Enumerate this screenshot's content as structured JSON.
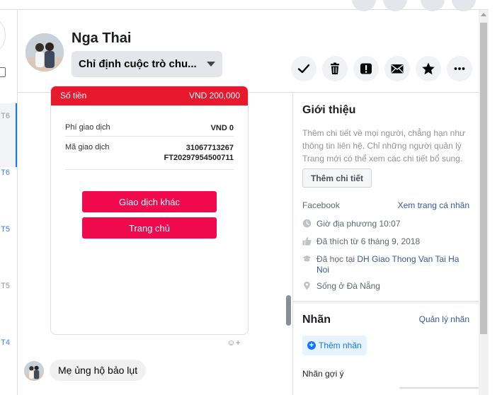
{
  "left_list": {
    "days": [
      "T6",
      "T6",
      "T5",
      "T5",
      "T4"
    ]
  },
  "contact": {
    "name": "Nga Thai",
    "assign_label": "Chỉ định cuộc trò chu..."
  },
  "actions": [
    {
      "name": "mark-done-button",
      "icon": "check-icon"
    },
    {
      "name": "delete-button",
      "icon": "trash-icon"
    },
    {
      "name": "report-button",
      "icon": "alert-icon"
    },
    {
      "name": "mark-unread-button",
      "icon": "envelope-icon"
    },
    {
      "name": "star-button",
      "icon": "star-icon"
    },
    {
      "name": "more-button",
      "icon": "more-icon"
    }
  ],
  "receipt": {
    "header_left": "Số tiền",
    "header_right": "VND  200,000",
    "fee_label": "Phí giao dịch",
    "fee_value": "VND 0",
    "code_label": "Mã giao dịch",
    "code_value_1": "31067713267",
    "code_value_2": "FT20297954500711",
    "button_other": "Giao dịch khác",
    "button_home": "Trang chủ",
    "accent": "#f0094c"
  },
  "message": {
    "text": "Mẹ ủng hộ bảo lụt"
  },
  "info": {
    "about_title": "Giới thiệu",
    "about_desc": "Thêm chi tiết về mọi người, chẳng hạn như thông tin liên hệ. Chỉ những người quản lý Trang mới có thể xem các chi tiết bổ sung.",
    "add_detail_label": "Thêm chi tiết",
    "facebook_label": "Facebook",
    "profile_link": "Xem trang cá nhân",
    "local_time": "Giờ địa phương 10:07",
    "liked_since": "Đã thích từ 6 tháng 9, 2018",
    "studied_prefix": "Đã học tại ",
    "studied_school": "DH Giao Thong Van Tai Ha Noi",
    "lives_in": "Sống ở Đà Nẵng",
    "labels_title": "Nhãn",
    "manage_labels": "Quản lý nhãn",
    "add_label": "Thêm nhãn",
    "suggested_labels": "Nhãn gợi ý"
  }
}
